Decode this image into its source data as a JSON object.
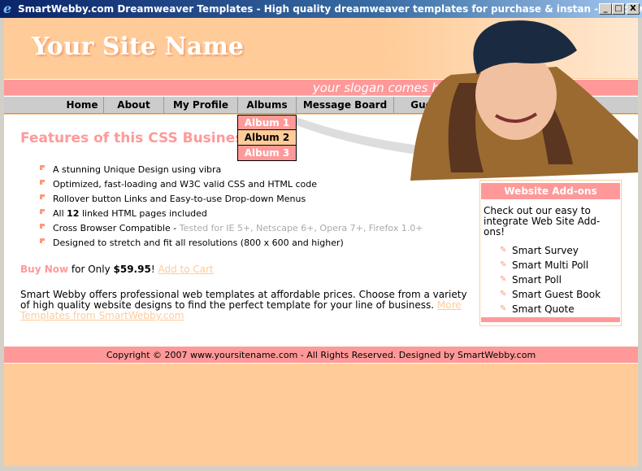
{
  "window": {
    "title": "SmartWebby.com Dreamweaver Templates - High quality dreamweaver templates for purchase & instan - Windows Interne...",
    "minimize": "_",
    "maximize": "□",
    "close": "X"
  },
  "header": {
    "site_name": "Your Site Name",
    "slogan": "your slogan comes here.."
  },
  "nav": {
    "items": [
      "Home",
      "About Us",
      "My Profile",
      "Albums",
      "Message Board",
      "Guest Boo"
    ]
  },
  "dropdown": {
    "items": [
      "Album 1",
      "Album 2",
      "Album 3"
    ]
  },
  "main": {
    "title": "Features of this CSS Busines",
    "features": [
      {
        "text": "A stunning Unique Design using vibra"
      },
      {
        "text": "Optimized, fast-loading and W3C valid CSS and HTML code"
      },
      {
        "text": "Rollover button Links and Easy-to-use Drop-down Menus"
      },
      {
        "pre": "All ",
        "bold": "12",
        "post": " linked HTML pages included"
      },
      {
        "text": "Cross Browser Compatible - ",
        "gray": "Tested for IE 5+, Netscape 6+, Opera 7+, Firefox 1.0+"
      },
      {
        "text": "Designed to stretch and fit all resolutions (800 x 600 and higher)"
      }
    ],
    "buy_now": "Buy Now",
    "for_only": " for Only ",
    "price": "$59.95",
    "excl": "!",
    "add_to_cart": "Add to Cart",
    "about": "Smart Webby offers professional web templates at affordable prices. Choose from a variety of high quality website designs to find the perfect template for your line of business. ",
    "more_link": "More Templates from SmartWebby.com"
  },
  "sidebar": {
    "title": "Website Add-ons",
    "intro": "Check out our easy to integrate Web Site Add-ons!",
    "items": [
      "Smart Survey",
      "Smart Multi Poll",
      "Smart Poll",
      "Smart Guest Book",
      "Smart Quote"
    ]
  },
  "footer": {
    "text": "Copyright © 2007 www.yoursitename.com - All Rights Reserved. Designed by SmartWebby.com"
  },
  "colors": {
    "peach": "#ffcc99",
    "pink": "#ff9999",
    "nav_gray": "#cccccc"
  }
}
